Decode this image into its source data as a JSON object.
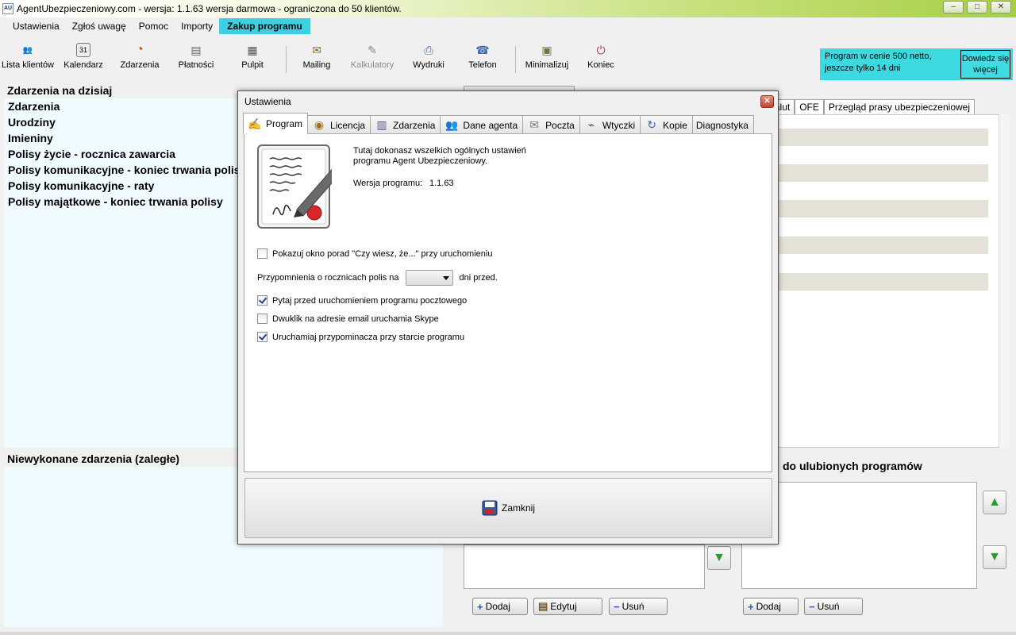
{
  "window": {
    "title": "AgentUbezpieczeniowy.com - wersja: 1.1.63 wersja darmowa - ograniczona do 50 klientów.",
    "logo_text": "AU",
    "controls": {
      "minimize": "–",
      "maximize": "□",
      "close": "✕"
    }
  },
  "menu": {
    "items": [
      "Ustawienia",
      "Zgłoś uwagę",
      "Pomoc",
      "Importy"
    ],
    "highlight": "Zakup programu"
  },
  "toolbar": {
    "buttons": [
      {
        "label": "Lista klientów",
        "icon": "users-icon",
        "glyph": "👥"
      },
      {
        "label": "Kalendarz",
        "icon": "calendar-icon",
        "glyph": "31"
      },
      {
        "label": "Zdarzenia",
        "icon": "clock-icon",
        "glyph": "◔"
      },
      {
        "label": "Płatności",
        "icon": "payments-icon",
        "glyph": "▤"
      },
      {
        "label": "Pulpit",
        "icon": "desktop-icon",
        "glyph": "▦"
      },
      {
        "label": "Mailing",
        "icon": "mailing-icon",
        "glyph": "✉"
      },
      {
        "label": "Kalkulatory",
        "icon": "calculator-icon",
        "glyph": "✎"
      },
      {
        "label": "Wydruki",
        "icon": "printer-icon",
        "glyph": "⎙"
      },
      {
        "label": "Telefon",
        "icon": "phone-icon",
        "glyph": "☎"
      },
      {
        "label": "Minimalizuj",
        "icon": "minimize-icon",
        "glyph": "▣"
      },
      {
        "label": "Koniec",
        "icon": "exit-icon",
        "glyph": "⏻"
      }
    ]
  },
  "promo": {
    "text": "Program w cenie 500 netto, jeszcze tylko 14 dni",
    "button": "Dowiedz się więcej"
  },
  "left": {
    "header": "Zdarzenia na dzisiaj",
    "items": [
      "Zdarzenia",
      "Urodziny",
      "Imieniny",
      "Polisy życie - rocznica zawarcia",
      "Polisy komunikacyjne - koniec trwania polisy",
      "Polisy komunikacyjne - raty",
      "Polisy majątkowe - koniec trwania polisy"
    ],
    "overdue_header": "Niewykonane zdarzenia (zaległe)"
  },
  "right": {
    "tabs": [
      "y walut",
      "OFE",
      "Przegląd prasy ubezpieczeniowej"
    ],
    "favorites_header": "do ulubionych programów",
    "left_buttons": [
      "Dodaj",
      "Edytuj",
      "Usuń"
    ],
    "right_buttons": [
      "Dodaj",
      "Usuń"
    ]
  },
  "dialog": {
    "title": "Ustawienia",
    "tabs": [
      {
        "label": "Program",
        "icon": "certificate-icon",
        "glyph": "✍"
      },
      {
        "label": "Licencja",
        "icon": "license-icon",
        "glyph": "◉"
      },
      {
        "label": "Zdarzenia",
        "icon": "events-icon",
        "glyph": "▥"
      },
      {
        "label": "Dane agenta",
        "icon": "agent-icon",
        "glyph": "👥"
      },
      {
        "label": "Poczta",
        "icon": "mail-icon",
        "glyph": "✉"
      },
      {
        "label": "Wtyczki",
        "icon": "plug-icon",
        "glyph": "⌁"
      },
      {
        "label": "Kopie",
        "icon": "backup-icon",
        "glyph": "↻"
      },
      {
        "label": "Diagnostyka",
        "icon": "diagnostics-icon",
        "glyph": ""
      }
    ],
    "intro": "Tutaj dokonasz wszelkich ogólnych ustawień programu Agent Ubezpieczeniowy.",
    "version_label": "Wersja programu:",
    "version_value": "1.1.63",
    "options": {
      "show_tips": {
        "label": "Pokazuj okno porad \"Czy wiesz, że...\" przy uruchomieniu",
        "checked": false
      },
      "reminder_prefix": "Przypomnienia o rocznicach polis na",
      "reminder_value": "",
      "reminder_suffix": "dni przed.",
      "ask_mail": {
        "label": "Pytaj przed uruchomieniem programu pocztowego",
        "checked": true
      },
      "skype": {
        "label": "Dwuklik na adresie email uruchamia Skype",
        "checked": false
      },
      "reminder_start": {
        "label": "Uruchamiaj przypominacza przy starcie programu",
        "checked": true
      }
    },
    "close_button": "Zamknij"
  }
}
